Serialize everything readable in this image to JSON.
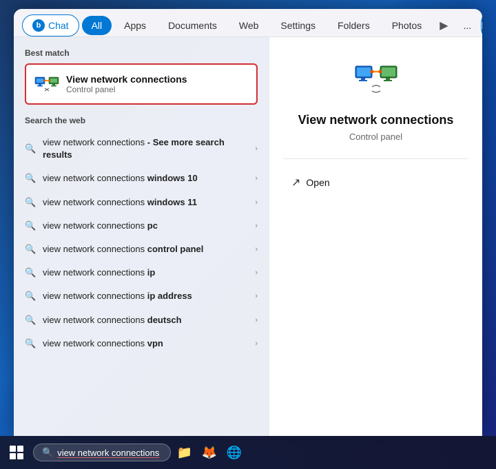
{
  "tabs": {
    "chat": "Chat",
    "all": "All",
    "apps": "Apps",
    "documents": "Documents",
    "web": "Web",
    "settings": "Settings",
    "folders": "Folders",
    "photos": "Photos",
    "more": "..."
  },
  "best_match": {
    "section_label": "Best match",
    "title": "View network connections",
    "subtitle": "Control panel"
  },
  "search_web": {
    "section_label": "Search the web",
    "results": [
      {
        "text": "view network connections",
        "bold": " - See more search results"
      },
      {
        "text": "view network connections ",
        "bold": "windows 10"
      },
      {
        "text": "view network connections ",
        "bold": "windows 11"
      },
      {
        "text": "view network connections ",
        "bold": "pc"
      },
      {
        "text": "view network connections ",
        "bold": "control panel"
      },
      {
        "text": "view network connections ",
        "bold": "ip"
      },
      {
        "text": "view network connections ",
        "bold": "ip address"
      },
      {
        "text": "view network connections ",
        "bold": "deutsch"
      },
      {
        "text": "view network connections ",
        "bold": "vpn"
      }
    ]
  },
  "right_panel": {
    "title": "View network connections",
    "subtitle": "Control panel",
    "open_label": "Open"
  },
  "taskbar": {
    "search_query": "view network connections"
  }
}
